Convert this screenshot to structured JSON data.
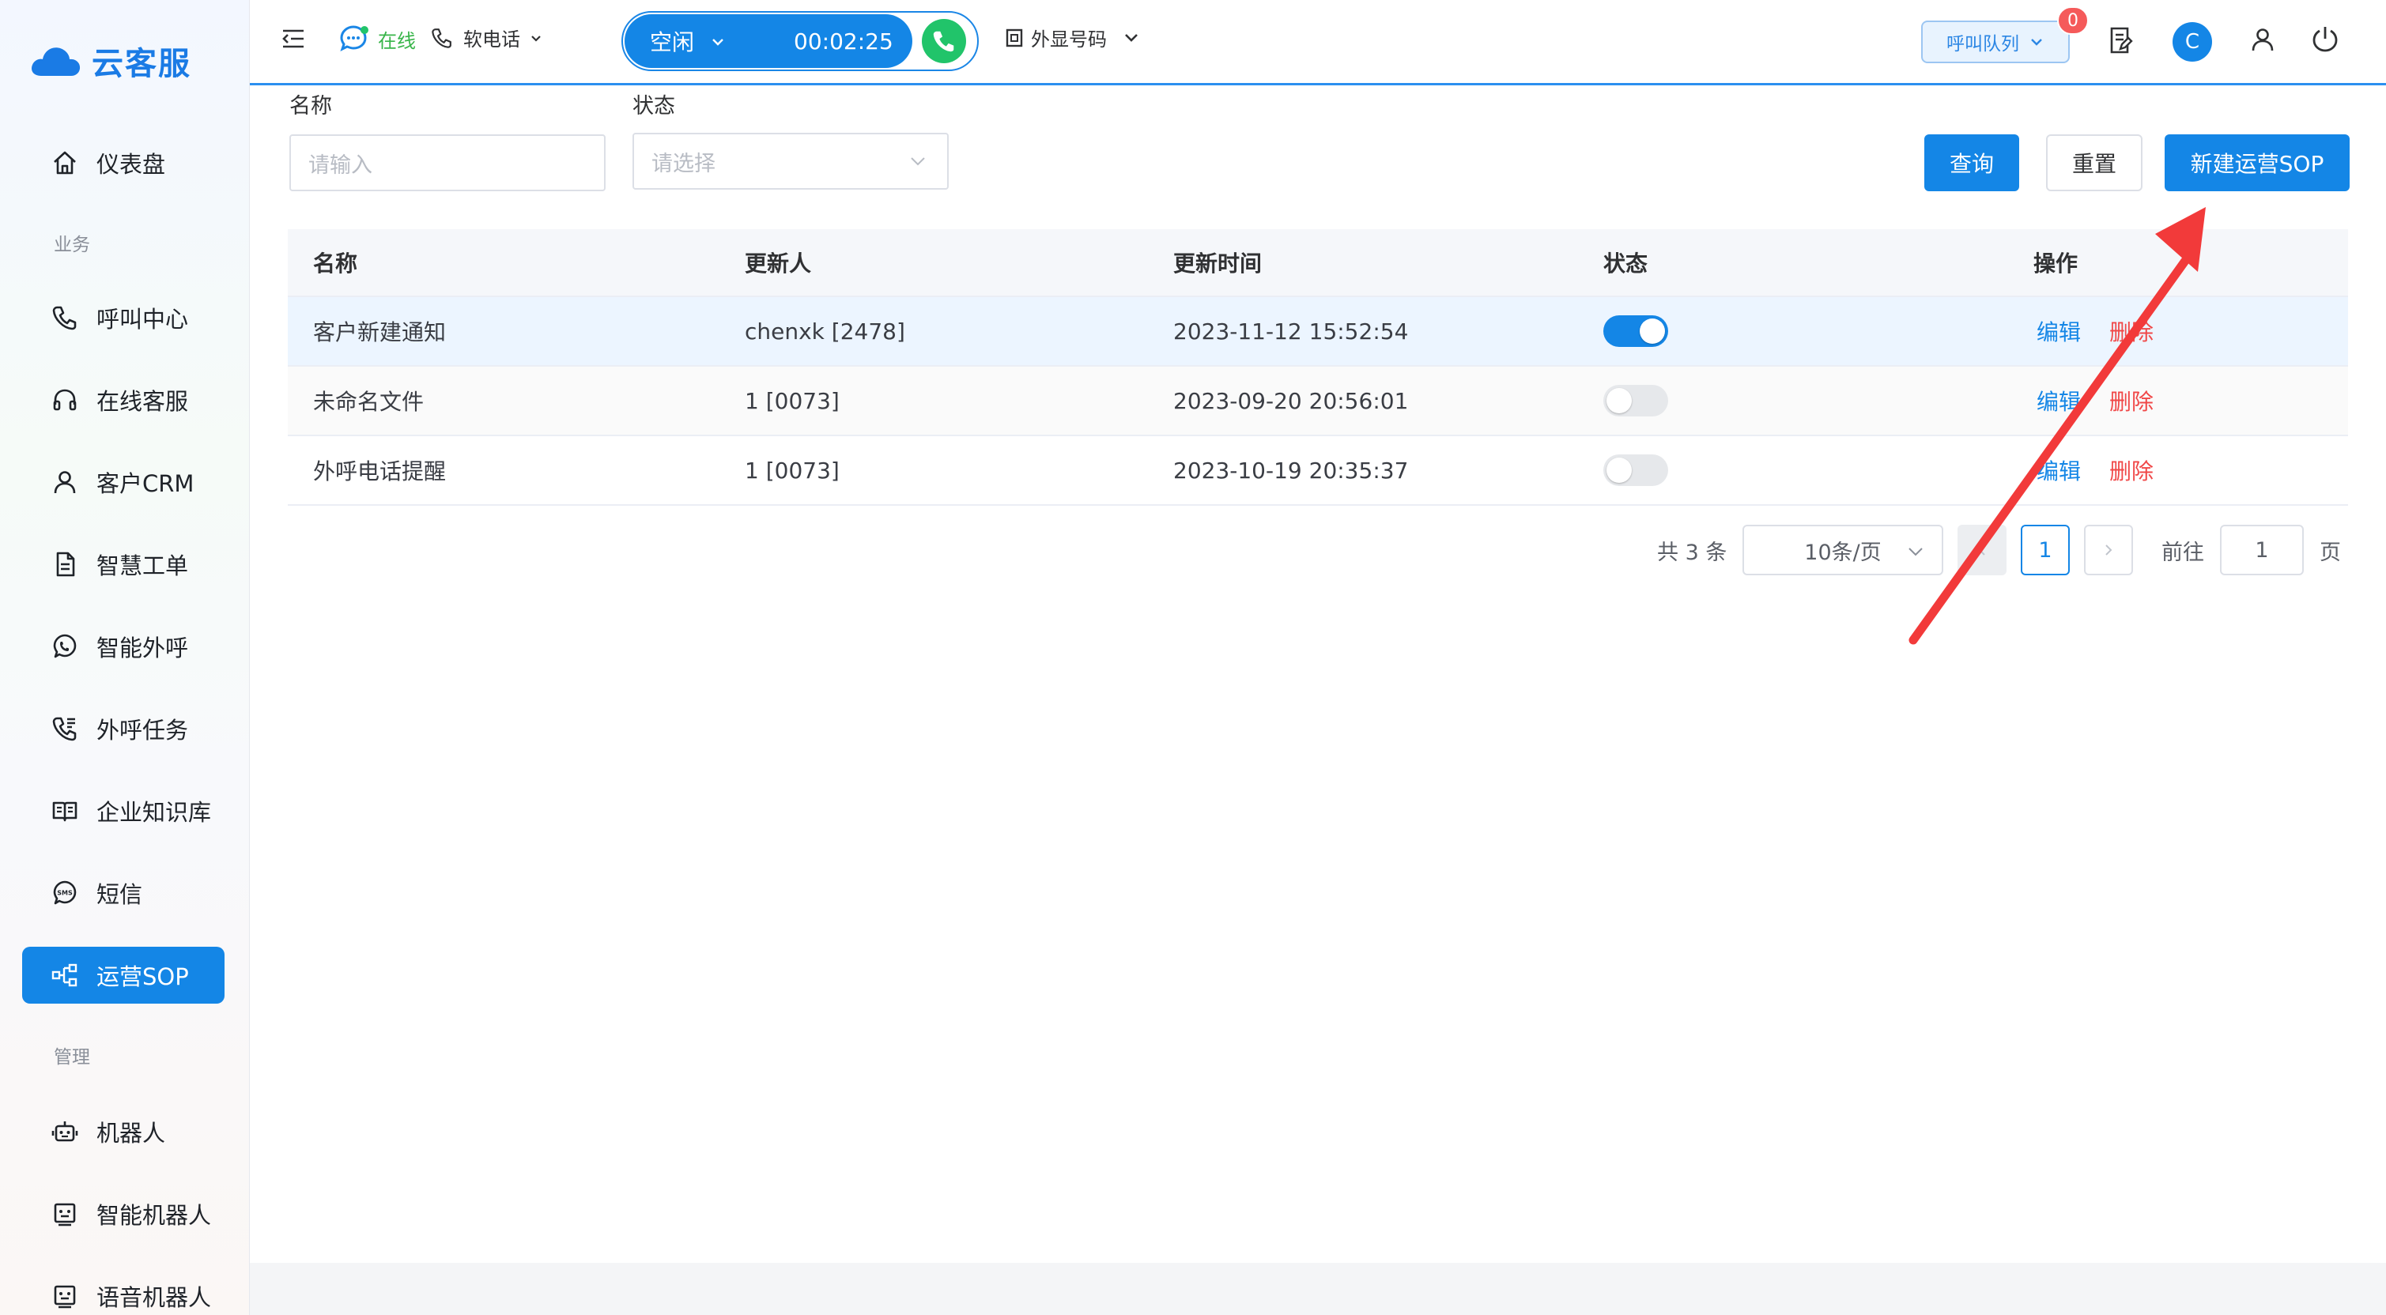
{
  "app": {
    "name": "云客服"
  },
  "sidebar": {
    "items": [
      {
        "label": "仪表盘",
        "icon": "home-icon"
      },
      {
        "label": "呼叫中心",
        "icon": "phone-icon"
      },
      {
        "label": "在线客服",
        "icon": "headset-icon"
      },
      {
        "label": "客户CRM",
        "icon": "user-icon"
      },
      {
        "label": "智慧工单",
        "icon": "document-icon"
      },
      {
        "label": "智能外呼",
        "icon": "whatsapp-phone-icon"
      },
      {
        "label": "外呼任务",
        "icon": "phone-task-icon"
      },
      {
        "label": "企业知识库",
        "icon": "book-icon"
      },
      {
        "label": "短信",
        "icon": "sms-icon"
      },
      {
        "label": "运营SOP",
        "icon": "flow-icon"
      },
      {
        "label": "机器人",
        "icon": "robot-icon"
      },
      {
        "label": "智能机器人",
        "icon": "smart-robot-icon"
      },
      {
        "label": "语音机器人",
        "icon": "voice-robot-icon"
      }
    ],
    "sections": {
      "business": "业务",
      "management": "管理"
    }
  },
  "topbar": {
    "online": "在线",
    "softphone": "软电话",
    "status": "空闲",
    "timer": "00:02:25",
    "outbound_number": "外显号码",
    "queue": "呼叫队列",
    "queue_badge": "0",
    "avatar_letter": "C"
  },
  "filters": {
    "name_label": "名称",
    "name_placeholder": "请输入",
    "status_label": "状态",
    "status_placeholder": "请选择",
    "query": "查询",
    "reset": "重置",
    "create": "新建运营SOP"
  },
  "table": {
    "headers": [
      "名称",
      "更新人",
      "更新时间",
      "状态",
      "操作"
    ],
    "rows": [
      {
        "name": "客户新建通知",
        "updater": "chenxk [2478]",
        "time": "2023-11-12 15:52:54",
        "enabled": true
      },
      {
        "name": "未命名文件",
        "updater": "1 [0073]",
        "time": "2023-09-20 20:56:01",
        "enabled": false
      },
      {
        "name": "外呼电话提醒",
        "updater": "1 [0073]",
        "time": "2023-10-19 20:35:37",
        "enabled": false
      }
    ],
    "edit": "编辑",
    "delete": "删除"
  },
  "pagination": {
    "total": "共 3 条",
    "page_size": "10条/页",
    "current": "1",
    "goto_label": "前往",
    "goto_value": "1",
    "page_unit": "页"
  },
  "colors": {
    "primary": "#1486e6",
    "danger": "#f04848",
    "success": "#21c46a",
    "annotation": "#f23a3a"
  }
}
